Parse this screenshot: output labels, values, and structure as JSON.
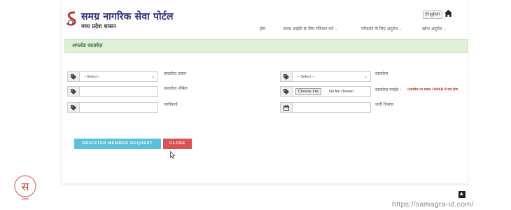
{
  "header": {
    "title": "समग्र नागरिक सेवा पोर्टल",
    "subtitle": "मध्य प्रदेश शासन",
    "language_button": "English",
    "nav": [
      {
        "label": "होम",
        "has_dropdown": false
      },
      {
        "label": "समग्र आईडी के लिए रजिस्टर करें",
        "has_dropdown": true
      },
      {
        "label": "परिवर्तन के लिए अनुरोध",
        "has_dropdown": true
      },
      {
        "label": "खोज अनुरोध",
        "has_dropdown": true
      }
    ],
    "chevron": "⌄"
  },
  "section": {
    "title": "अपलोड दस्तावेज़"
  },
  "form": {
    "doc_category_select": "--Select--",
    "doc_type_label": "दस्तावेज़ प्रकार",
    "doc_type_select": "-- Select --",
    "doc_label": "दस्तावेज़",
    "doc_title_label": "दस्तावेज़ शीर्षक",
    "choose_file_button": "Choose File",
    "no_file_text": "No file chosen",
    "doc_file_label": "दस्तावेज़ फाईल :",
    "doc_file_hint": "(दस्तावेज़ का साइज 100KB से कम होना",
    "issuer_label": "जारीकर्ता",
    "issue_date_label": "जारी दिनांक"
  },
  "buttons": {
    "register": "REGISTER MEMBER REQUEST",
    "close": "CLOSE"
  },
  "watermark": {
    "url": "https://samagra-id.com/",
    "logo_caption": "समग्र"
  },
  "icons": {
    "field_addon": "tag-icon",
    "date_addon": "calendar-icon",
    "home": "home-icon",
    "scroll": "chevron-up-icon"
  },
  "colors": {
    "brand": "#2e2f86",
    "logo_red": "#d0312d",
    "banner_bg": "#dff0d8",
    "banner_text": "#3c763d",
    "register_btn": "#5bc0de",
    "close_btn": "#d9534f"
  }
}
